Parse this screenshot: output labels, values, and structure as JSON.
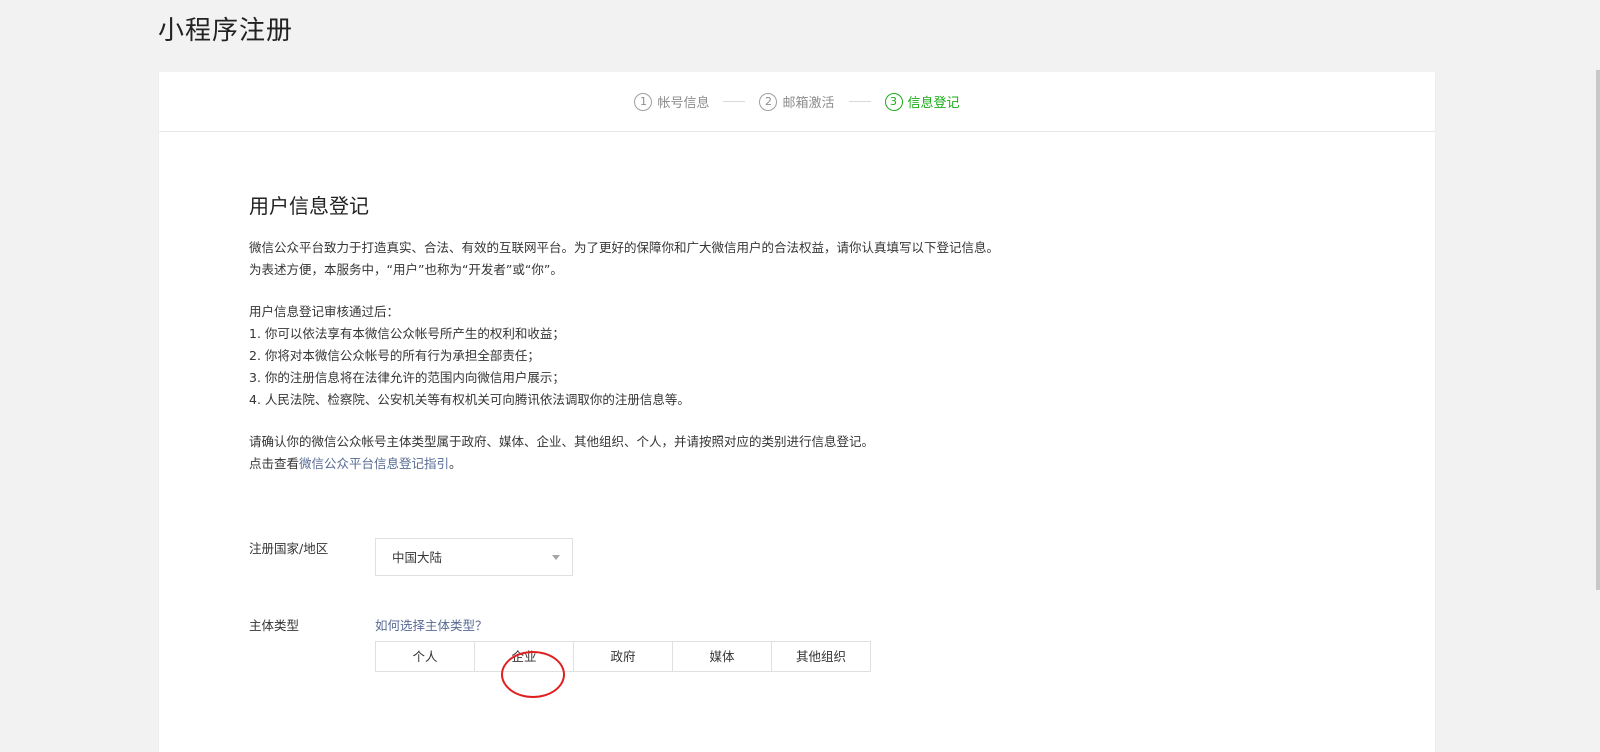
{
  "page": {
    "title": "小程序注册"
  },
  "steps": [
    {
      "num": "1",
      "label": "帐号信息",
      "state": "done"
    },
    {
      "num": "2",
      "label": "邮箱激活",
      "state": "done"
    },
    {
      "num": "3",
      "label": "信息登记",
      "state": "active"
    }
  ],
  "section": {
    "title": "用户信息登记",
    "intro": [
      "微信公众平台致力于打造真实、合法、有效的互联网平台。为了更好的保障你和广大微信用户的合法权益，请你认真填写以下登记信息。",
      "为表述方便，本服务中，“用户”也称为“开发者”或“你”。"
    ],
    "after_review": [
      "用户信息登记审核通过后：",
      "1. 你可以依法享有本微信公众帐号所产生的权利和收益；",
      "2. 你将对本微信公众帐号的所有行为承担全部责任；",
      "3. 你的注册信息将在法律允许的范围内向微信用户展示；",
      "4. 人民法院、检察院、公安机关等有权机关可向腾讯依法调取你的注册信息等。"
    ],
    "confirm": "请确认你的微信公众帐号主体类型属于政府、媒体、企业、其他组织、个人，并请按照对应的类别进行信息登记。",
    "guide_prefix": "点击查看",
    "guide_link": "微信公众平台信息登记指引",
    "guide_suffix": "。"
  },
  "form": {
    "country_label": "注册国家/地区",
    "country_value": "中国大陆",
    "type_label": "主体类型",
    "type_help": "如何选择主体类型？",
    "types": [
      "个人",
      "企业",
      "政府",
      "媒体",
      "其他组织"
    ]
  },
  "colors": {
    "accent_green": "#1aad19",
    "link_blue": "#576b95",
    "highlight_red": "#e02020"
  }
}
